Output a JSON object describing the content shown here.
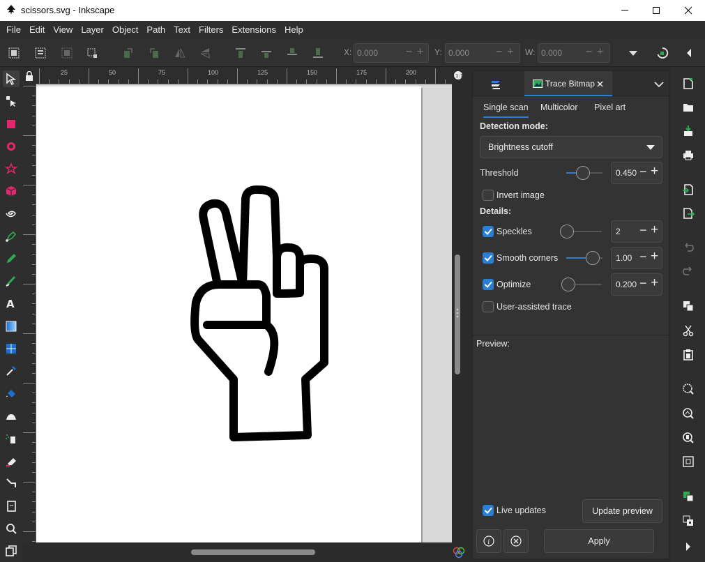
{
  "window": {
    "title": "scissors.svg - Inkscape"
  },
  "menu": [
    "File",
    "Edit",
    "View",
    "Layer",
    "Object",
    "Path",
    "Text",
    "Filters",
    "Extensions",
    "Help"
  ],
  "toolcontrols": {
    "x_label": "X:",
    "x_value": "0.000",
    "y_label": "Y:",
    "y_value": "0.000",
    "w_label": "W:",
    "w_value": "0.000"
  },
  "ruler": {
    "top_labels": [
      "25",
      "50",
      "75",
      "100",
      "125",
      "150",
      "175",
      "200"
    ]
  },
  "dock": {
    "tab_label": "Trace Bitmap",
    "subtabs": [
      "Single scan",
      "Multicolor",
      "Pixel art"
    ],
    "detection_mode_label": "Detection mode:",
    "detection_mode_value": "Brightness cutoff",
    "threshold_label": "Threshold",
    "threshold_value": "0.450",
    "invert_label": "Invert image",
    "invert_checked": false,
    "details_label": "Details:",
    "speckles_label": "Speckles",
    "speckles_value": "2",
    "speckles_checked": true,
    "smooth_label": "Smooth corners",
    "smooth_value": "1.00",
    "smooth_checked": true,
    "optimize_label": "Optimize",
    "optimize_value": "0.200",
    "optimize_checked": true,
    "user_assisted_label": "User-assisted trace",
    "user_assisted_checked": false,
    "preview_label": "Preview:",
    "live_updates_label": "Live updates",
    "live_updates_checked": true,
    "update_preview_label": "Update preview",
    "apply_label": "Apply"
  },
  "colors": {
    "accent": "#2a7fd4",
    "panel_bg": "#333333",
    "canvas_bg": "#d9d9d9"
  }
}
